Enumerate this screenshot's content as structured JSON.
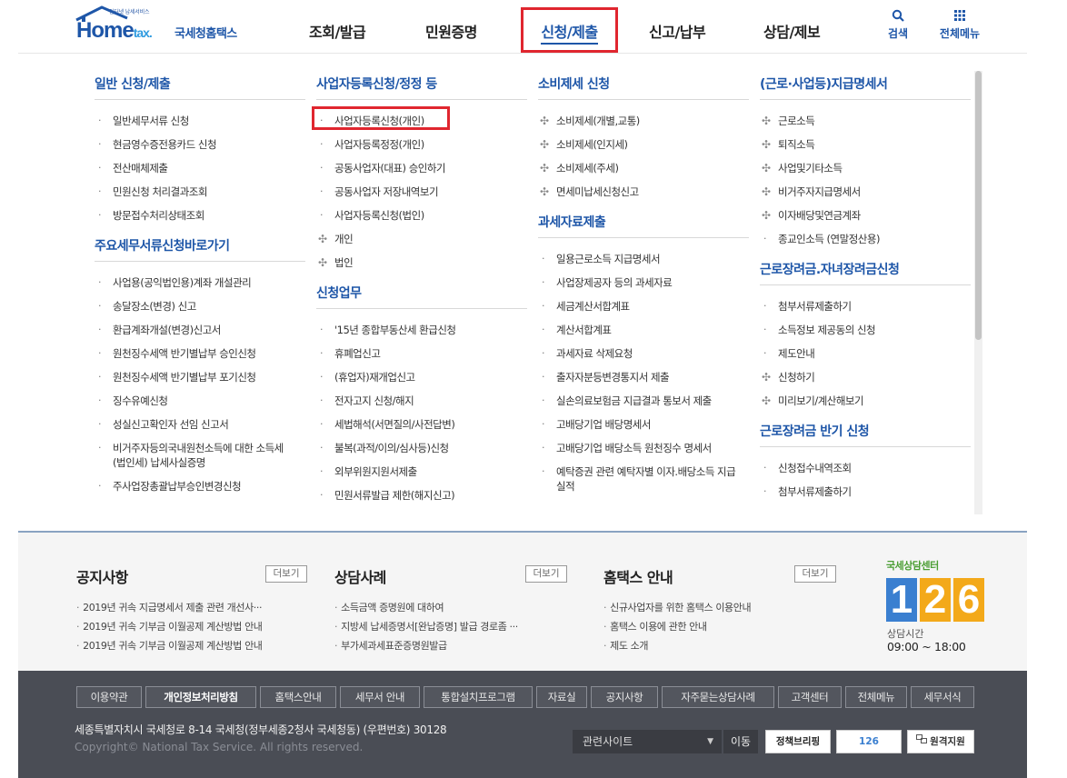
{
  "header": {
    "logo_small": "인터넷 납세서비스",
    "logo_home": "Home",
    "logo_tax": "tax.",
    "logo_brand": "국세청홈택스",
    "nav": [
      "조회/발급",
      "민원증명",
      "신청/제출",
      "신고/납부",
      "상담/제보"
    ],
    "active_nav": "신청/제출",
    "search_label": "검색",
    "allmenu_label": "전체메뉴"
  },
  "menu": {
    "col1": {
      "title": "일반 신청/제출",
      "items": [
        "일반세무서류 신청",
        "현금영수증전용카드 신청",
        "전산매체제출",
        "민원신청 처리결과조회",
        "방문접수처리상태조회"
      ],
      "title2": "주요세무서류신청바로가기",
      "items2": [
        "사업용(공익법인용)계좌 개설관리",
        "송달장소(변경) 신고",
        "환급계좌개설(변경)신고서",
        "원천징수세액 반기별납부 승인신청",
        "원천징수세액 반기별납부 포기신청",
        "징수유예신청",
        "성실신고확인자 선임 신고서",
        "비거주자등의국내원천소득에 대한 소득세(법인세) 납세사실증명",
        "주사업장총괄납부승인변경신청"
      ]
    },
    "col2": {
      "title": "사업자등록신청/정정 등",
      "items": [
        "사업자등록신청(개인)",
        "사업자등록정정(개인)",
        "공동사업자(대표) 승인하기",
        "공동사업자 저장내역보기",
        "사업자등록신청(법인)"
      ],
      "sub": [
        "개인",
        "법인"
      ],
      "title2": "신청업무",
      "items2": [
        "'15년 종합부동산세 환급신청",
        "휴폐업신고",
        "(휴업자)재개업신고",
        "전자고지 신청/해지",
        "세법해석(서면질의/사전답변)",
        "불복(과적/이의/심사등)신청",
        "외부위원지원서제출",
        "민원서류발급 제한(해지신고)"
      ]
    },
    "col3": {
      "title": "소비제세 신청",
      "items": [
        "소비제세(개별,교통)",
        "소비제세(인지세)",
        "소비제세(주세)",
        "면세미납세신청신고"
      ],
      "title2": "과세자료제출",
      "items2": [
        "일용근로소득 지급명세서",
        "사업장제공자 등의 과세자료",
        "세금계산서합계표",
        "계산서합계표",
        "과세자료 삭제요청",
        "출자자분등변경통지서 제출",
        "실손의료보험금 지급결과 통보서 제출",
        "고배당기업 배당명세서",
        "고배당기업 배당소득 원천징수 명세서",
        "예탁증권 관련 예탁자별 이자.배당소득 지급 실적"
      ]
    },
    "col4": {
      "title": "(근로·사업등)지급명세서",
      "items": [
        "근로소득",
        "퇴직소득",
        "사업및기타소득",
        "비거주자지급명세서",
        "이자배당및연금계좌",
        "종교인소득 (연말정산용)"
      ],
      "title2": "근로장려금.자녀장려금신청",
      "items2": [
        "첨부서류제출하기",
        "소득정보 제공동의 신청",
        "제도안내",
        "신청하기",
        "미리보기/계산해보기"
      ],
      "title3": "근로장려금 반기 신청",
      "items3": [
        "신청접수내역조회",
        "첨부서류제출하기"
      ]
    }
  },
  "lower": {
    "notice": {
      "title": "공지사항",
      "more": "더보기",
      "items": [
        "2019년 귀속 지급명세서 제출 관련 개선사···",
        "2019년 귀속 기부금 이월공제 계산방법 안내",
        "2019년 귀속 기부금 이월공제 계산방법 안내"
      ]
    },
    "cases": {
      "title": "상담사례",
      "more": "더보기",
      "items": [
        "소득금액 증명원에 대하여",
        "지방세 납세증명서[완납증명] 발급 경로좀 ···",
        "부가세과세표준증명원발급"
      ]
    },
    "guide": {
      "title": "홈택스 안내",
      "more": "더보기",
      "items": [
        "신규사업자를 위한 홈택스 이용안내",
        "홈택스 이용에 관한 안내",
        "제도 소개"
      ]
    },
    "center": {
      "title": "국세상담센터",
      "number": [
        "1",
        "2",
        "6"
      ],
      "label": "상담시간",
      "hours": "09:00 ~ 18:00"
    }
  },
  "footer": {
    "links": [
      "이용약관",
      "개인정보처리방침",
      "홈택스안내",
      "세무서 안내",
      "통합설치프로그램",
      "자료실",
      "공지사항",
      "자주묻는상담사례",
      "고객센터",
      "전체메뉴",
      "세무서식"
    ],
    "address": "세종특별자치시 국세청로 8-14 국세청(정부세종2청사 국세청동) (우편번호) 30128",
    "copyright": "Copyright© National Tax Service. All rights reserved.",
    "related_label": "관련사이트",
    "go_label": "이동",
    "btn1": "정책브리핑",
    "btn2": "126",
    "btn3": "원격지원"
  },
  "colors": {
    "accent": "#1e56a8",
    "highlight": "#e0262f",
    "footer_bg": "#4a4d55"
  }
}
